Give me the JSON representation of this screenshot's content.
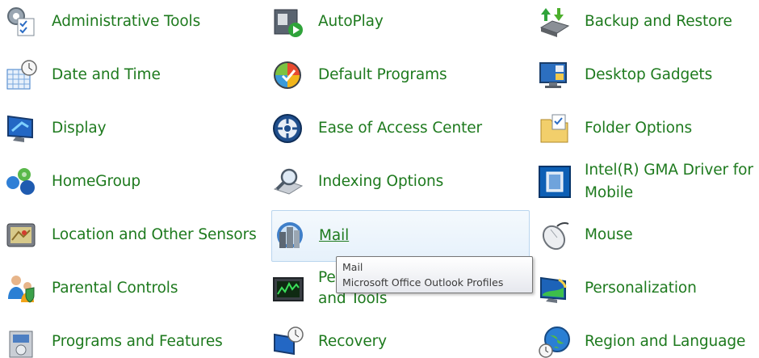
{
  "items": [
    {
      "label": "Administrative Tools",
      "icon": "administrative-tools-icon"
    },
    {
      "label": "AutoPlay",
      "icon": "autoplay-icon"
    },
    {
      "label": "Backup and Restore",
      "icon": "backup-restore-icon"
    },
    {
      "label": "Date and Time",
      "icon": "date-time-icon"
    },
    {
      "label": "Default Programs",
      "icon": "default-programs-icon"
    },
    {
      "label": "Desktop Gadgets",
      "icon": "desktop-gadgets-icon"
    },
    {
      "label": "Display",
      "icon": "display-icon"
    },
    {
      "label": "Ease of Access Center",
      "icon": "ease-of-access-icon"
    },
    {
      "label": "Folder Options",
      "icon": "folder-options-icon"
    },
    {
      "label": "HomeGroup",
      "icon": "homegroup-icon"
    },
    {
      "label": "Indexing Options",
      "icon": "indexing-options-icon"
    },
    {
      "label": "Intel(R) GMA Driver for Mobile",
      "icon": "intel-gma-icon"
    },
    {
      "label": "Location and Other Sensors",
      "icon": "location-sensors-icon"
    },
    {
      "label": "Mail",
      "icon": "mail-icon"
    },
    {
      "label": "Mouse",
      "icon": "mouse-icon"
    },
    {
      "label": "Parental Controls",
      "icon": "parental-controls-icon"
    },
    {
      "label": "Pe",
      "label_line2": "and Tools",
      "icon": "performance-icon"
    },
    {
      "label": "Personalization",
      "icon": "personalization-icon"
    },
    {
      "label": "Programs and Features",
      "icon": "programs-features-icon"
    },
    {
      "label": "Recovery",
      "icon": "recovery-icon"
    },
    {
      "label": "Region and Language",
      "icon": "region-language-icon"
    }
  ],
  "tooltip": {
    "title": "Mail",
    "description": "Microsoft Office Outlook Profiles"
  },
  "colors": {
    "link_green": "#1e7a1e",
    "hover_border": "#b9d5ee"
  }
}
